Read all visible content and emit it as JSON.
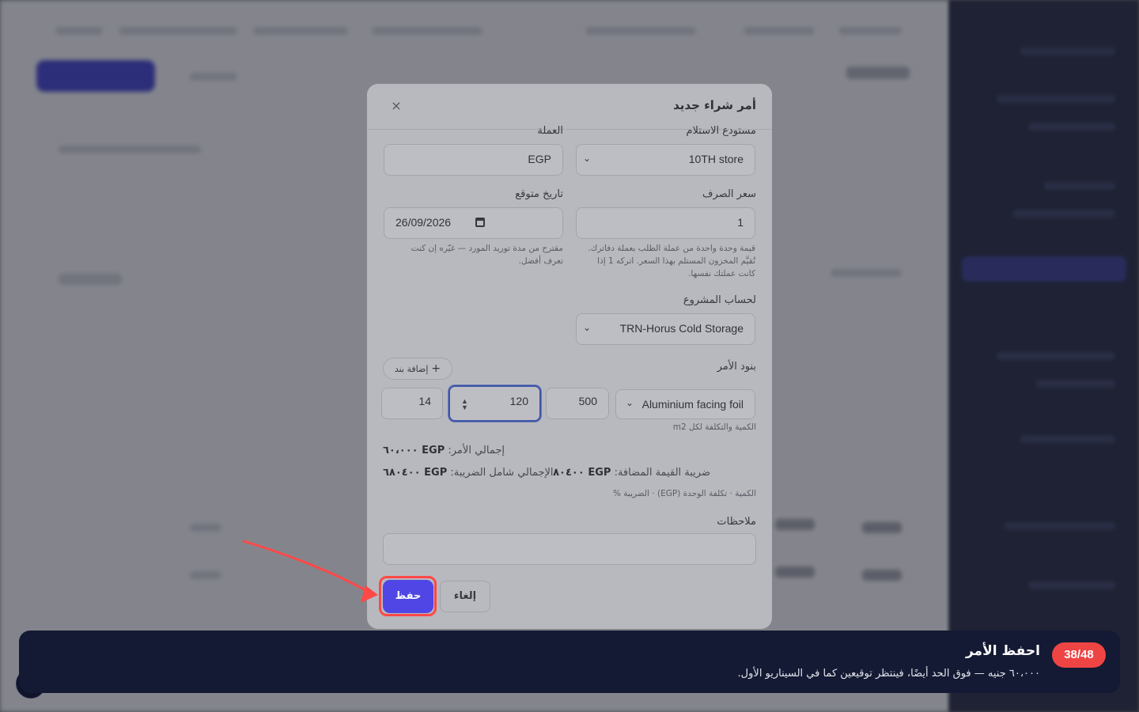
{
  "modal": {
    "title": "أمر شراء جديد",
    "close_icon": "×",
    "warehouse": {
      "label": "مستودع الاستلام",
      "value": "10TH store"
    },
    "currency": {
      "label": "العملة",
      "value": "EGP"
    },
    "exchange_rate": {
      "label": "سعر الصرف",
      "value": "1",
      "help": "قيمة وحدة واحدة من عملة الطلب بعملة دفاترك. تُقيَّم المخزون المستلم بهذا السعر. اتركه 1 إذا كانت عملتك نفسها."
    },
    "expected_date": {
      "label": "تاريخ متوقع",
      "value": "26/09/2026",
      "help": "مقترح من مدة توريد المورد — غيّره إن كنت تعرف أفضل."
    },
    "project": {
      "label": "لحساب المشروع",
      "value": "TRN-Horus Cold Storage"
    },
    "items": {
      "label": "بنود الأمر",
      "add_label": "إضافة بند",
      "row": {
        "product": "Aluminium facing foil",
        "quantity": "500",
        "unit_cost": "120",
        "tax": "14"
      },
      "unit_note": "الكمية والتكلفة لكل m2"
    },
    "totals": {
      "order_total_label": "إجمالي الأمر:",
      "order_total_value": "EGP ٦٠،٠٠٠",
      "vat_label": "ضريبة القيمة المضافة:",
      "vat_value": "EGP ٨٠٤٠٠",
      "grand_total_label": "الإجمالي شامل الضريبة:",
      "grand_total_value": "EGP ٦٨٠٤٠٠",
      "columns_note": "الكمية · تكلفة الوحدة (EGP) · الضريبة %"
    },
    "notes": {
      "label": "ملاحظات",
      "value": ""
    },
    "cancel_label": "إلغاء",
    "save_label": "حفظ"
  },
  "toast": {
    "step": "38/48",
    "title": "احفظ الأمر",
    "description": "٦٠،٠٠٠ جنيه — فوق الحد أيضًا، فينتظر توقيعين كما في السيناريو الأول."
  },
  "colors": {
    "primary": "#4f46e5",
    "highlight": "#ff4848",
    "toast_bg": "#141a33",
    "badge": "#ef4444"
  }
}
